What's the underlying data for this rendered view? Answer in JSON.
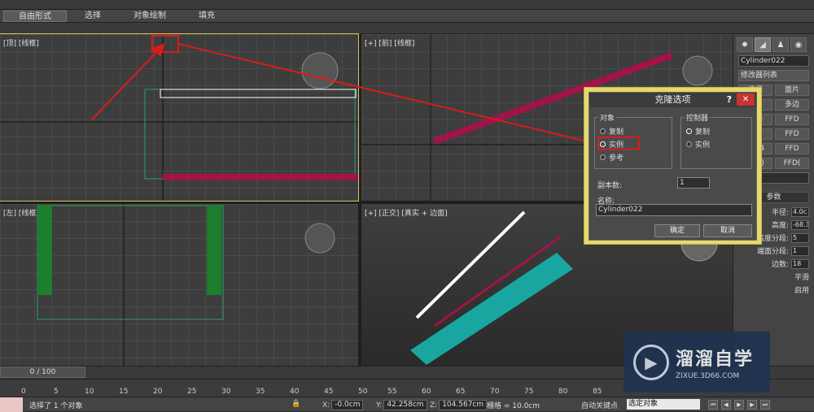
{
  "ribbon": {
    "tabs": [
      "自由形式",
      "选择",
      "对象绘制",
      "填充"
    ]
  },
  "viewports": {
    "top": "[顶] [线框]",
    "front": "[+] [前] [线框]",
    "left": "[左] [线框]",
    "persp": "[+] [正交] [真实 + 边面]"
  },
  "cmdpanel": {
    "object_name": "Cylinder022",
    "modifier_list": "修改器列表",
    "mod_buttons": [
      "选择",
      "面片",
      "曲",
      "多边",
      "选择",
      "FFD",
      "化",
      "FFD",
      "x4x4",
      "FFD",
      "柱体)",
      "FFD(",
      "linder"
    ],
    "params_header": "参数",
    "params": [
      {
        "label": "半径:",
        "value": "4.0c"
      },
      {
        "label": "高度:",
        "value": "-68.3"
      },
      {
        "label": "高度分段:",
        "value": "5"
      },
      {
        "label": "端面分段:",
        "value": "1"
      },
      {
        "label": "边数:",
        "value": "18"
      },
      {
        "label": "平滑",
        "value": ""
      },
      {
        "label": "启用",
        "value": ""
      }
    ]
  },
  "dialog": {
    "title": "克隆选项",
    "help": "?",
    "close": "✕",
    "object_group": "对象",
    "object_options": [
      "复制",
      "实例",
      "参考"
    ],
    "controller_group": "控制器",
    "controller_options": [
      "复制",
      "实例"
    ],
    "copies_label": "副本数:",
    "copies_value": "1",
    "name_label": "名称:",
    "name_value": "Cylinder022",
    "ok": "确定",
    "cancel": "取消"
  },
  "timeline": {
    "slider": "0 / 100"
  },
  "ruler": [
    "0",
    "5",
    "10",
    "15",
    "20",
    "25",
    "30",
    "35",
    "40",
    "45",
    "50",
    "55",
    "60",
    "65",
    "70",
    "75",
    "80",
    "85"
  ],
  "status": {
    "message": "选择了 1 个对象",
    "x_label": "X:",
    "x_value": "-0.0cm",
    "y_label": "Y:",
    "y_value": "42.258cm",
    "z_label": "Z:",
    "z_value": "104.567cm",
    "grid": "栅格 = 10.0cm",
    "auto_key": "自动关键点",
    "selection": "选定对象"
  },
  "watermark": {
    "title": "溜溜自学",
    "sub": "ZIXUE.3D66.COM"
  },
  "colors": {
    "highlight": "#d8c658",
    "dialog_border": "#e7d86b",
    "arrow": "#d81c1c"
  }
}
